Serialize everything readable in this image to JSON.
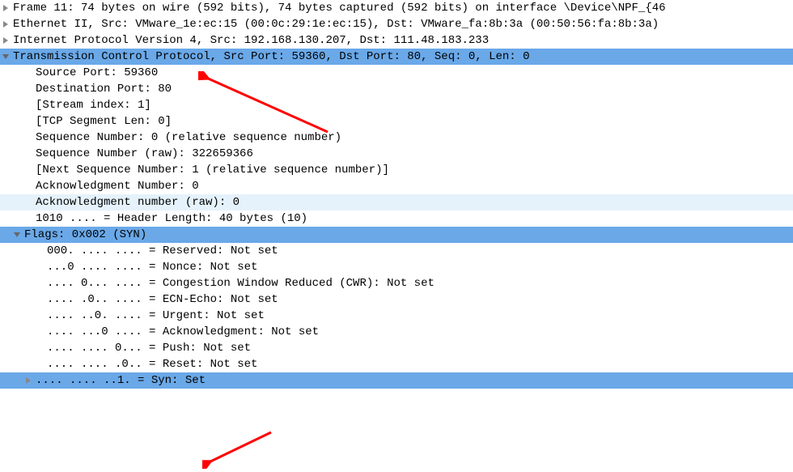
{
  "lines": [
    {
      "indent": 0,
      "expander": "right",
      "hl": "",
      "text": "Frame 11: 74 bytes on wire (592 bits), 74 bytes captured (592 bits) on interface \\Device\\NPF_{46"
    },
    {
      "indent": 0,
      "expander": "right",
      "hl": "",
      "text": "Ethernet II, Src: VMware_1e:ec:15 (00:0c:29:1e:ec:15), Dst: VMware_fa:8b:3a (00:50:56:fa:8b:3a)"
    },
    {
      "indent": 0,
      "expander": "right",
      "hl": "",
      "text": "Internet Protocol Version 4, Src: 192.168.130.207, Dst: 111.48.183.233"
    },
    {
      "indent": 0,
      "expander": "down",
      "hl": "blue",
      "text": "Transmission Control Protocol, Src Port: 59360, Dst Port: 80, Seq: 0, Len: 0"
    },
    {
      "indent": 2,
      "expander": "",
      "hl": "",
      "text": "Source Port: 59360"
    },
    {
      "indent": 2,
      "expander": "",
      "hl": "",
      "text": "Destination Port: 80"
    },
    {
      "indent": 2,
      "expander": "",
      "hl": "",
      "text": "[Stream index: 1]"
    },
    {
      "indent": 2,
      "expander": "",
      "hl": "",
      "text": "[TCP Segment Len: 0]"
    },
    {
      "indent": 2,
      "expander": "",
      "hl": "",
      "text": "Sequence Number: 0    (relative sequence number)"
    },
    {
      "indent": 2,
      "expander": "",
      "hl": "",
      "text": "Sequence Number (raw): 322659366"
    },
    {
      "indent": 2,
      "expander": "",
      "hl": "",
      "text": "[Next Sequence Number: 1    (relative sequence number)]"
    },
    {
      "indent": 2,
      "expander": "",
      "hl": "",
      "text": "Acknowledgment Number: 0"
    },
    {
      "indent": 2,
      "expander": "",
      "hl": "light",
      "text": "Acknowledgment number (raw): 0"
    },
    {
      "indent": 2,
      "expander": "",
      "hl": "",
      "text": "1010 .... = Header Length: 40 bytes (10)"
    },
    {
      "indent": 1,
      "expander": "down",
      "hl": "blue",
      "text": "Flags: 0x002 (SYN)"
    },
    {
      "indent": 3,
      "expander": "",
      "hl": "",
      "text": "000. .... .... = Reserved: Not set"
    },
    {
      "indent": 3,
      "expander": "",
      "hl": "",
      "text": "...0 .... .... = Nonce: Not set"
    },
    {
      "indent": 3,
      "expander": "",
      "hl": "",
      "text": ".... 0... .... = Congestion Window Reduced (CWR): Not set"
    },
    {
      "indent": 3,
      "expander": "",
      "hl": "",
      "text": ".... .0.. .... = ECN-Echo: Not set"
    },
    {
      "indent": 3,
      "expander": "",
      "hl": "",
      "text": ".... ..0. .... = Urgent: Not set"
    },
    {
      "indent": 3,
      "expander": "",
      "hl": "",
      "text": ".... ...0 .... = Acknowledgment: Not set"
    },
    {
      "indent": 3,
      "expander": "",
      "hl": "",
      "text": ".... .... 0... = Push: Not set"
    },
    {
      "indent": 3,
      "expander": "",
      "hl": "",
      "text": ".... .... .0.. = Reset: Not set"
    },
    {
      "indent": 2,
      "expander": "right",
      "hl": "blue",
      "text": ".... .... ..1. = Syn: Set"
    }
  ]
}
